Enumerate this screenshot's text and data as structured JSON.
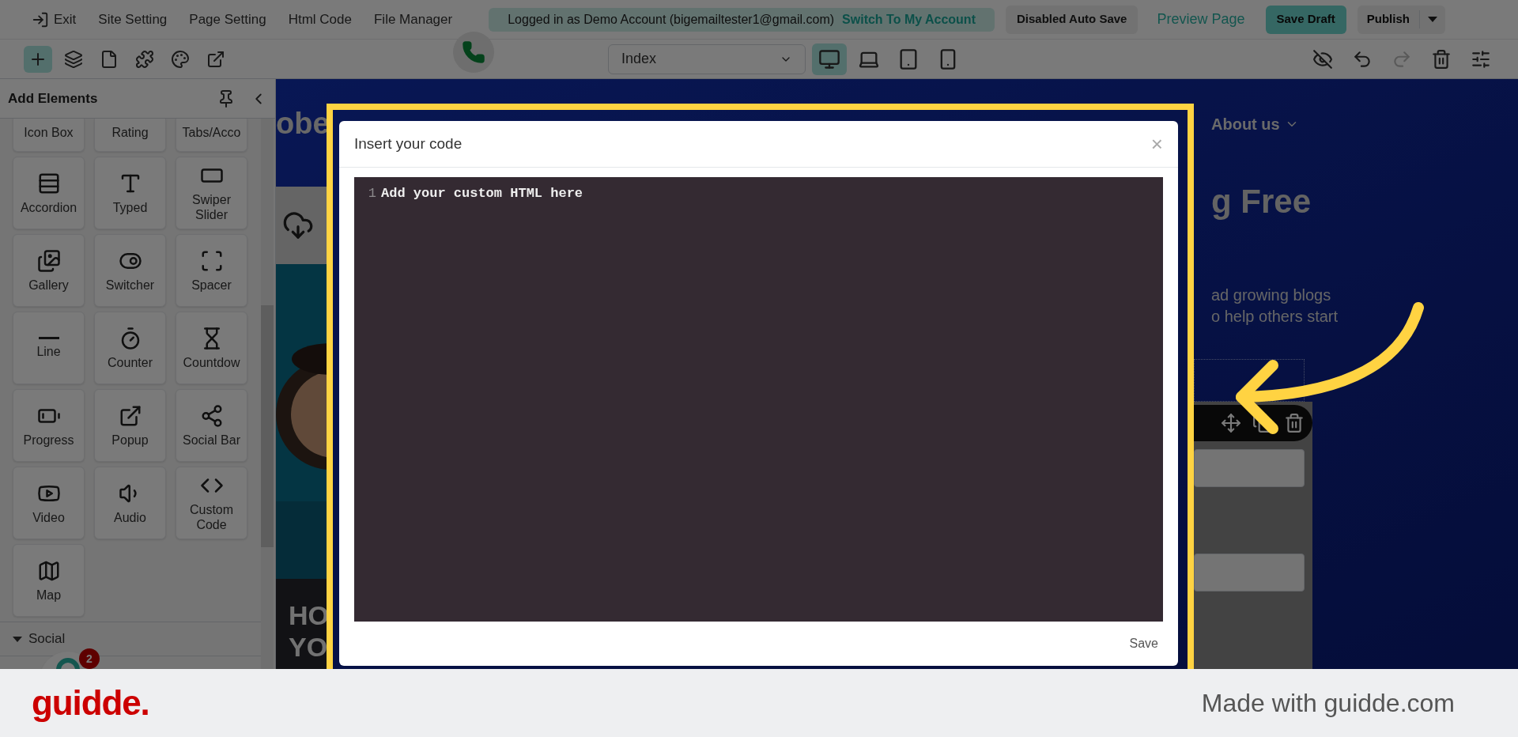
{
  "top_menu": [
    {
      "label": "Exit",
      "kind": "exit"
    },
    {
      "label": "Site Setting"
    },
    {
      "label": "Page Setting"
    },
    {
      "label": "Html Code"
    },
    {
      "label": "File Manager"
    }
  ],
  "login_banner": {
    "text": "Logged in as Demo Account (bigemailtester1@gmail.com)",
    "link": "Switch To My Account"
  },
  "actions": {
    "auto_save": "Disabled Auto Save",
    "preview": "Preview Page",
    "save_draft": "Save Draft",
    "publish": "Publish"
  },
  "tools": [
    {
      "kind": "add",
      "selected": true
    },
    {
      "kind": "layers",
      "selected": false
    },
    {
      "kind": "page",
      "selected": false
    },
    {
      "kind": "plugin",
      "selected": false
    },
    {
      "kind": "theme",
      "selected": false
    },
    {
      "kind": "open",
      "selected": false
    }
  ],
  "page_select": {
    "value": "Index"
  },
  "devices": [
    {
      "kind": "desktop",
      "selected": true
    },
    {
      "kind": "laptop",
      "selected": false
    },
    {
      "kind": "tablet",
      "selected": false
    },
    {
      "kind": "phone",
      "selected": false
    }
  ],
  "edit_tools": [
    {
      "kind": "hide",
      "disabled": false
    },
    {
      "kind": "undo",
      "disabled": false
    },
    {
      "kind": "redo",
      "disabled": true
    },
    {
      "kind": "delete",
      "disabled": false
    },
    {
      "kind": "settings",
      "disabled": false
    }
  ],
  "sidebar": {
    "title": "Add Elements",
    "elements": [
      {
        "label": "Icon Box"
      },
      {
        "label": "Rating"
      },
      {
        "label": "Tabs/Acco"
      },
      {
        "label": "Accordion",
        "kind": "accordion"
      },
      {
        "label": "Typed",
        "kind": "typed"
      },
      {
        "label": "Swiper Slider",
        "kind": "slider"
      },
      {
        "label": "Gallery",
        "kind": "gallery"
      },
      {
        "label": "Switcher",
        "kind": "switcher"
      },
      {
        "label": "Spacer",
        "kind": "spacer"
      },
      {
        "label": "Line",
        "kind": "line"
      },
      {
        "label": "Counter",
        "kind": "counter"
      },
      {
        "label": "Countdow",
        "kind": "countdown"
      },
      {
        "label": "Progress",
        "kind": "progress"
      },
      {
        "label": "Popup",
        "kind": "popup"
      },
      {
        "label": "Social Bar",
        "kind": "social"
      },
      {
        "label": "Video",
        "kind": "video"
      },
      {
        "label": "Audio",
        "kind": "audio"
      },
      {
        "label": "Custom Code",
        "kind": "code"
      },
      {
        "label": "Map",
        "kind": "map"
      }
    ],
    "section": {
      "label": "Social",
      "expanded": true
    }
  },
  "chat": {
    "badge": "2"
  },
  "canvas": {
    "logo": "obe",
    "nav": "About us",
    "heading": "g Free",
    "text_lines": [
      "ad growing blogs",
      "o help others start"
    ],
    "banner_lines": [
      "HO",
      "YO"
    ]
  },
  "modal": {
    "title": "Insert your code",
    "close": "×",
    "lines": [
      {
        "number": "1",
        "code": "Add your custom HTML here"
      }
    ],
    "save": "Save"
  },
  "footer": {
    "logo": "guidde.",
    "credit": "Made with guidde.com"
  }
}
